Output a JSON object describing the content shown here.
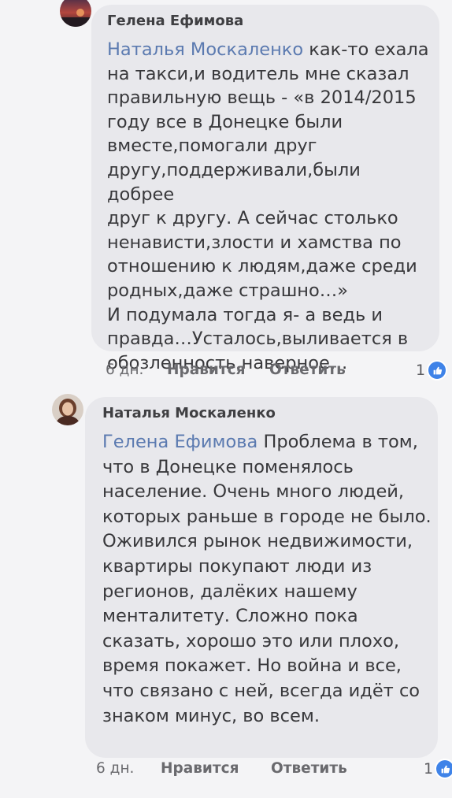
{
  "comments": [
    {
      "author": "Гелена Ефимова",
      "mention": "Наталья Москаленко",
      "lines": [
        " как-то ехала",
        "на такси,и водитель мне сказал",
        "правильную вещь - «в 2014/2015",
        "году все в Донецке были",
        "вместе,помогали друг",
        "другу,поддерживали,были добрее",
        "друг к другу. А сейчас столько",
        "ненависти,злости и хамства по",
        "отношению к людям,даже среди",
        "родных,даже страшно…»",
        "И подумала тогда я- а ведь и",
        "правда…Усталось,выливается в",
        "обозленность,наверное…"
      ],
      "time": "6 дн.",
      "like_label": "Нравится",
      "reply_label": "Ответить",
      "reaction_count": "1",
      "reaction_icon": "like-icon",
      "reaction_color": "#3f83e8"
    },
    {
      "author": "Наталья Москаленко",
      "mention": "Гелена Ефимова",
      "lines": [
        " Проблема в том,",
        "что в Донецке поменялось",
        "население. Очень много людей,",
        "которых раньше в городе не было.",
        "Оживился рынок недвижимости,",
        "квартиры покупают люди из",
        "регионов, далёких нашему",
        "менталитету. Сложно пока",
        "сказать, хорошо это или плохо,",
        "время покажет. Но война и все,",
        "что связано с ней, всегда идёт со",
        "знаком минус, во всем."
      ],
      "time": "6 дн.",
      "like_label": "Нравится",
      "reply_label": "Ответить",
      "reaction_count": "1",
      "reaction_icon": "like-icon",
      "reaction_color": "#3f83e8"
    }
  ]
}
